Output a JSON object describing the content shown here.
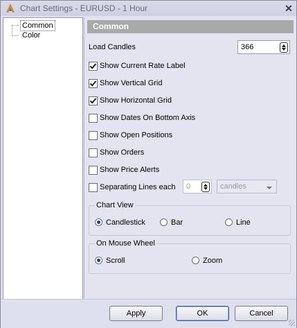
{
  "window": {
    "title": "Chart Settings - EURUSD - 1 Hour",
    "close_glyph": "✕"
  },
  "tree": {
    "items": [
      {
        "label": "Common",
        "selected": true
      },
      {
        "label": "Color",
        "selected": false
      }
    ]
  },
  "section": {
    "title": "Common"
  },
  "load_candles": {
    "label": "Load Candles",
    "value": "366"
  },
  "checkboxes": [
    {
      "label": "Show Current Rate Label",
      "checked": true
    },
    {
      "label": "Show Vertical Grid",
      "checked": true
    },
    {
      "label": "Show Horizontal Grid",
      "checked": true
    },
    {
      "label": "Show Dates On Bottom Axis",
      "checked": false
    },
    {
      "label": "Show Open Positions",
      "checked": false
    },
    {
      "label": "Show Orders",
      "checked": false
    },
    {
      "label": "Show Price Alerts",
      "checked": false
    }
  ],
  "separating_lines": {
    "label": "Separating Lines each",
    "checked": false,
    "value": "0",
    "unit": "candles"
  },
  "chart_view": {
    "title": "Chart View",
    "options": [
      {
        "label": "Candlestick",
        "selected": true
      },
      {
        "label": "Bar",
        "selected": false
      },
      {
        "label": "Line",
        "selected": false
      }
    ]
  },
  "mouse_wheel": {
    "title": "On Mouse Wheel",
    "options": [
      {
        "label": "Scroll",
        "selected": true
      },
      {
        "label": "Zoom",
        "selected": false
      }
    ]
  },
  "buttons": {
    "apply": "Apply",
    "ok": "OK",
    "cancel": "Cancel"
  },
  "icons": {
    "app": "app-logo-icon",
    "close": "close-icon"
  },
  "colors": {
    "header_bg": "#a9a9a9",
    "panel_bg": "#e4e4f0",
    "radio_dot": "#1b3e8a"
  }
}
